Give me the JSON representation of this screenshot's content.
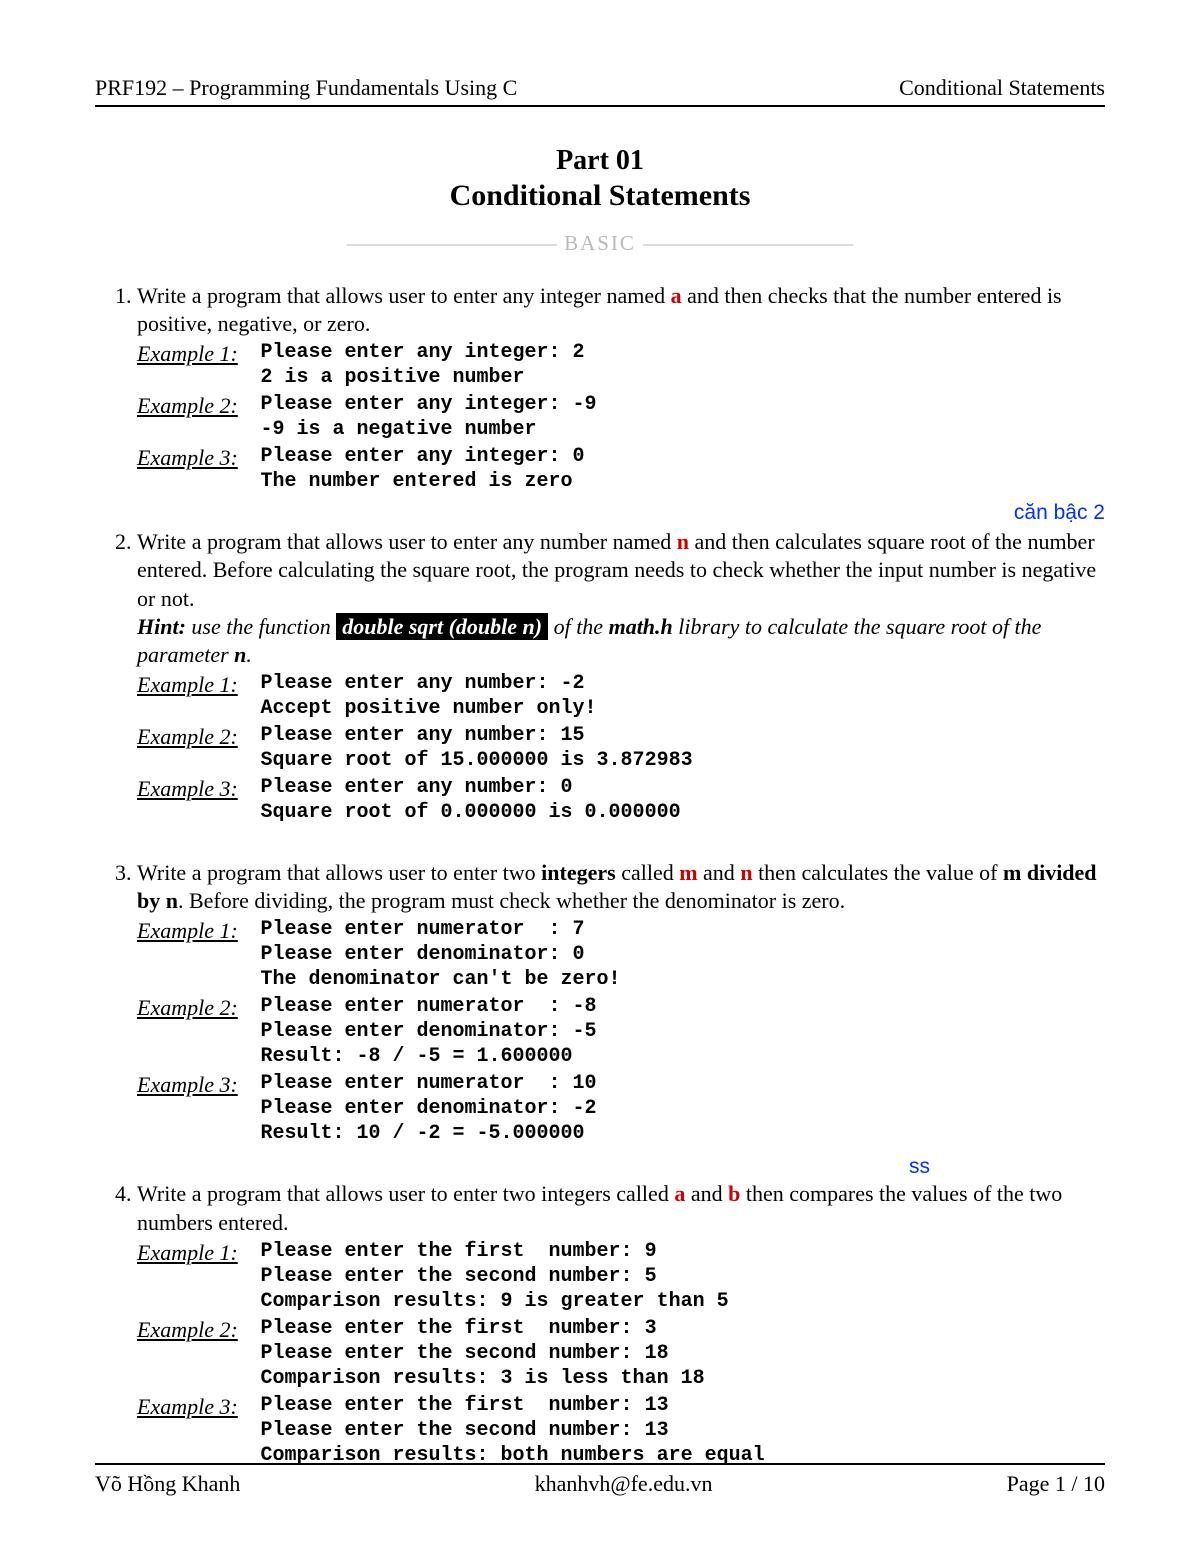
{
  "header": {
    "left": "PRF192 – Programming Fundamentals Using C",
    "right": "Conditional Statements"
  },
  "title": {
    "part": "Part 01",
    "main": "Conditional Statements"
  },
  "level": {
    "dash_left": "——————————",
    "text": " BASIC ",
    "dash_right": "——————————"
  },
  "p1": {
    "t1": "Write a program that allows user to enter any integer named ",
    "a": "a",
    "t2": " and then checks that the number entered is positive, negative, or zero.",
    "ex1_label": "Example 1:",
    "ex1_code": "Please enter any integer: 2\n2 is a positive number",
    "ex2_label": "Example 2:",
    "ex2_code": "Please enter any integer: -9\n-9 is a negative number",
    "ex3_label": "Example 3:",
    "ex3_code": "Please enter any integer: 0\nThe number entered is zero"
  },
  "p2": {
    "annot": "căn bậc 2",
    "t1": "Write a program that allows user to enter any number named ",
    "n": "n",
    "t2": " and then calculates square root of the number entered. Before calculating the square root, the program needs to check whether the input number is negative or not.",
    "hint_lead": "Hint:",
    "hint_t1": " use the function ",
    "hint_box": "double sqrt (double n)",
    "hint_t2": " of the ",
    "hint_mathh": "math.h",
    "hint_t3": " library to calculate the square root of the parameter ",
    "hint_n": "n",
    "hint_dot": ".",
    "ex1_label": "Example 1:",
    "ex1_code": "Please enter any number: -2\nAccept positive number only!",
    "ex2_label": "Example 2:",
    "ex2_code": "Please enter any number: 15\nSquare root of 15.000000 is 3.872983",
    "ex3_label": "Example 3:",
    "ex3_code": "Please enter any number: 0\nSquare root of 0.000000 is 0.000000"
  },
  "p3": {
    "t1": "Write a program that allows user to enter two ",
    "integers": "integers",
    "t2": " called ",
    "m": "m",
    "t3": " and ",
    "n": "n",
    "t4": " then calculates the value of ",
    "mdiv": "m divided by n",
    "t5": ". Before dividing, the program must check whether the denominator is zero.",
    "ex1_label": "Example 1:",
    "ex1_code": "Please enter numerator  : 7\nPlease enter denominator: 0\nThe denominator can't be zero!",
    "ex2_label": "Example 2:",
    "ex2_code": "Please enter numerator  : -8\nPlease enter denominator: -5\nResult: -8 / -5 = 1.600000",
    "ex3_label": "Example 3:",
    "ex3_code": "Please enter numerator  : 10\nPlease enter denominator: -2\nResult: 10 / -2 = -5.000000"
  },
  "p4": {
    "annot": "ss",
    "t1": "Write a program that allows user to enter two integers called ",
    "a": "a",
    "t2": " and ",
    "b": "b",
    "t3": " then compares the values of the two numbers entered.",
    "ex1_label": "Example 1:",
    "ex1_code": "Please enter the first  number: 9\nPlease enter the second number: 5\nComparison results: 9 is greater than 5",
    "ex2_label": "Example 2:",
    "ex2_code": "Please enter the first  number: 3\nPlease enter the second number: 18\nComparison results: 3 is less than 18",
    "ex3_label": "Example 3:",
    "ex3_code": "Please enter the first  number: 13\nPlease enter the second number: 13\nComparison results: both numbers are equal"
  },
  "footer": {
    "author": "Võ Hồng Khanh",
    "email": "khanhvh@fe.edu.vn",
    "page": "Page 1 / 10"
  }
}
